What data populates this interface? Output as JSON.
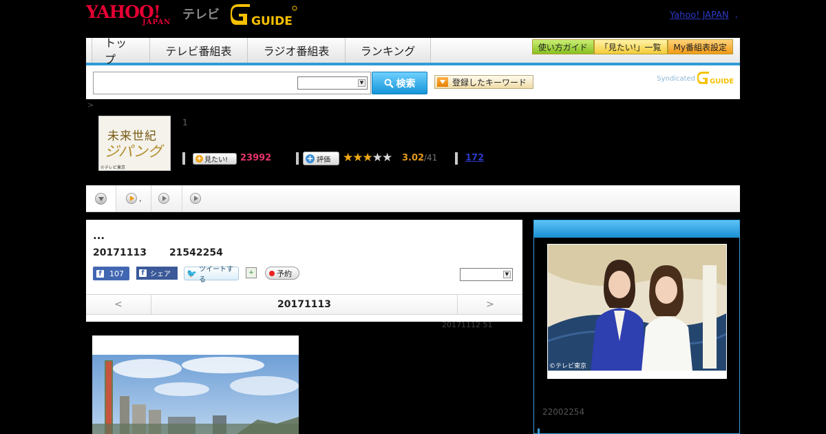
{
  "header": {
    "brand_yahoo": "YAHOO!",
    "brand_japan": "JAPAN",
    "brand_tv": "テレビ",
    "brand_gguide": "GUIDE",
    "yahoo_japan_link": "Yahoo! JAPAN",
    "link_suffix": ","
  },
  "nav": {
    "tabs": [
      {
        "label": "トップ"
      },
      {
        "label": "テレビ番組表"
      },
      {
        "label": "ラジオ番組表"
      },
      {
        "label": "ランキング"
      }
    ],
    "buttons": [
      {
        "label": "使い方ガイド"
      },
      {
        "label": "「見たい!」一覧"
      },
      {
        "label": "My番組表設定"
      }
    ],
    "colors": {
      "accent": "#2f9bd6"
    }
  },
  "search": {
    "input_value": "",
    "select_value": "",
    "button_label": "検索",
    "keyword_button": "登録したキーワード",
    "syndicated_label": "Syndicated",
    "syndicated_brand": "GUIDE"
  },
  "breadcrumb": {
    "separator": ">"
  },
  "program": {
    "thumb_title": "未来世紀",
    "thumb_subtitle": "ジパング",
    "thumb_copyright": "©テレビ東京",
    "episode_number": "1",
    "mitai_label": "見たい!",
    "mitai_count": "23992",
    "hyoka_label": "評価",
    "stars_filled": 3,
    "stars_total": 5,
    "rating": "3.02",
    "rating_votes": "/41",
    "review_count": "172"
  },
  "subtabs": [
    {
      "label": ""
    },
    {
      "label": ","
    },
    {
      "label": ""
    },
    {
      "label": ""
    }
  ],
  "detail": {
    "title": "...",
    "date": "20171113",
    "time": "21542254",
    "fb_like_count": "107",
    "fb_share_label": "シェア",
    "tweet_label": "ツイートする",
    "yoyaku_label": "予約",
    "select_value": ""
  },
  "date_nav": {
    "prev": "<",
    "current": "20171113",
    "next": ">"
  },
  "update_info": "20171112  51",
  "right_column": {
    "photo_copyright": "©テレビ東京",
    "text": "22002254"
  }
}
